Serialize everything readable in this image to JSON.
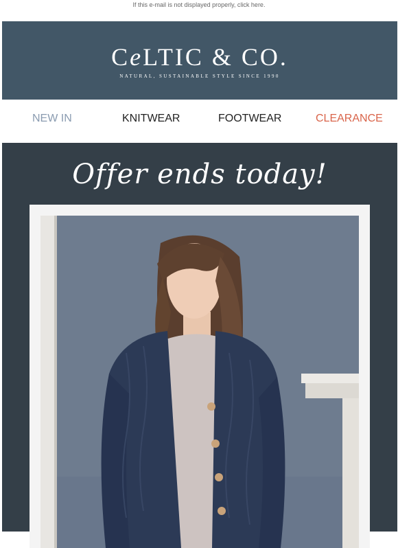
{
  "preheader": {
    "text": "If this e-mail is not displayed properly, click here."
  },
  "brand": {
    "logo_text_a": "C",
    "logo_text_e": "e",
    "logo_text_b": "LTIC & CO.",
    "tagline": "NATURAL, SUSTAINABLE STYLE SINCE 1990"
  },
  "nav": {
    "items": [
      {
        "label": "NEW IN",
        "color": "#8a9bb0"
      },
      {
        "label": "KNITWEAR",
        "color": "#222222"
      },
      {
        "label": "FOOTWEAR",
        "color": "#222222"
      },
      {
        "label": "CLEARANCE",
        "color": "#d9644a"
      }
    ]
  },
  "hero": {
    "headline": "Offer ends today!",
    "image_alt": "woman-wearing-navy-cable-knit-cardigan"
  },
  "colors": {
    "header_bg": "#425767",
    "hero_bg": "#343f48",
    "accent_clearance": "#d9644a"
  }
}
